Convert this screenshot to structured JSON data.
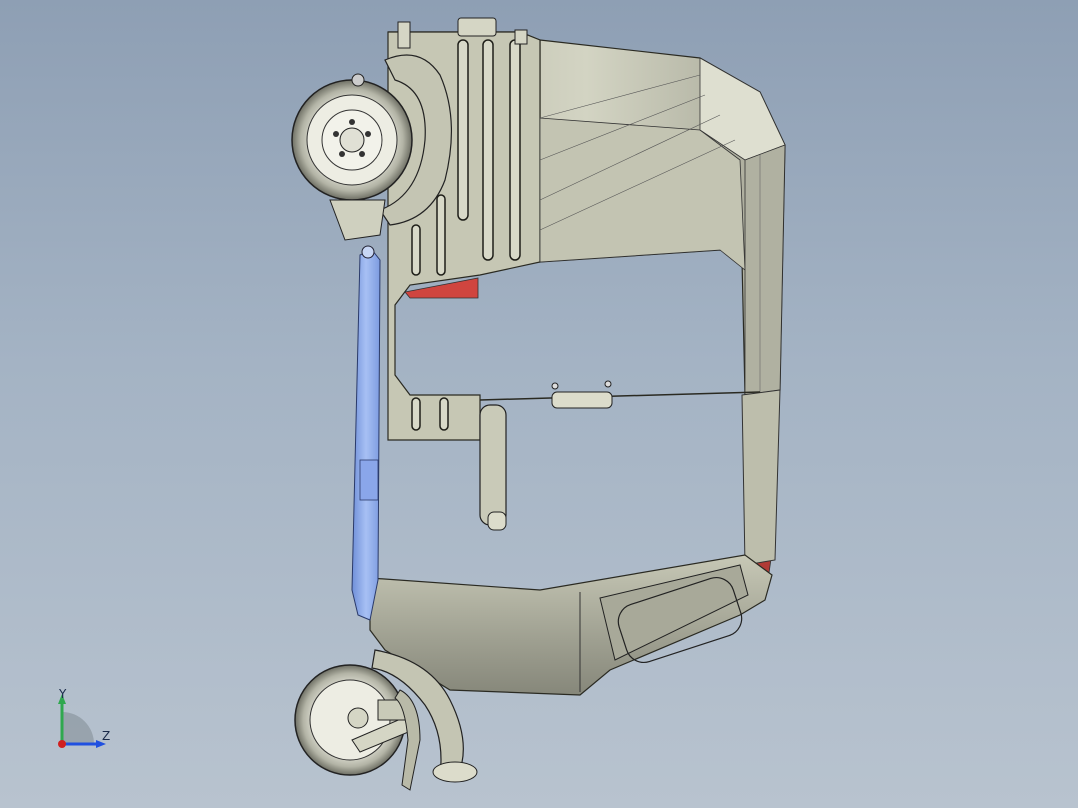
{
  "viewport": {
    "background_top": "#8e9fb4",
    "background_bottom": "#b8c3cf",
    "body_color": "#c9cab8",
    "accent_red": "#d0453f",
    "blue_part": "#9db7f0",
    "wheel_color": "#e6e6dc"
  },
  "triad": {
    "y_label": "Y",
    "z_label": "Z",
    "y_color": "#2fa84f",
    "z_color": "#2050e0",
    "x_color": "#d02020"
  }
}
